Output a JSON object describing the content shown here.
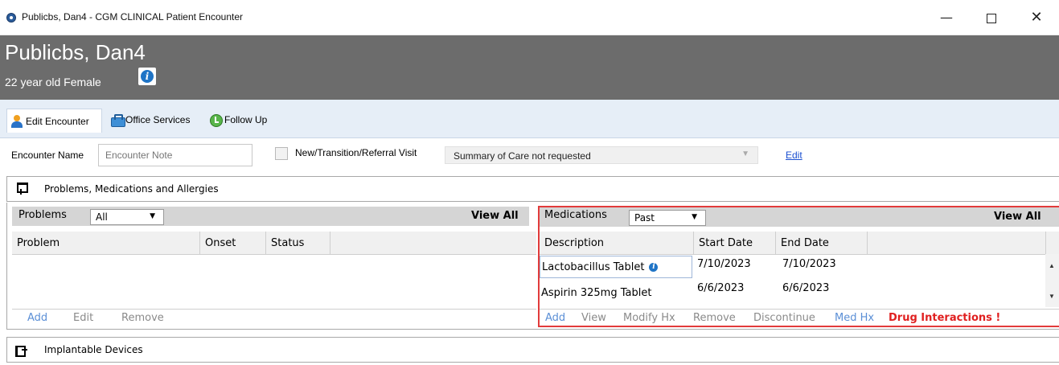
{
  "window": {
    "title": "Publicbs, Dan4 - CGM CLINICAL Patient Encounter",
    "minimize": "—",
    "close": "✕"
  },
  "patient": {
    "name": "Publicbs, Dan4",
    "summary": "22 year old Female",
    "info_icon": "i"
  },
  "tabs": [
    {
      "label": "Edit Encounter",
      "icon": "person-icon"
    },
    {
      "label": "Office Services",
      "icon": "bag-icon"
    },
    {
      "label": "Follow Up",
      "icon": "clock-icon"
    }
  ],
  "encounter": {
    "name_label": "Encounter Name",
    "note_placeholder": "Encounter Note",
    "visit_label": "New/Transition/Referral Visit",
    "summary_value": "Summary of Care not requested",
    "edit_link": "Edit"
  },
  "sections": {
    "pma_label": "Problems, Medications and Allergies",
    "devices_label": "Implantable Devices"
  },
  "problems": {
    "title": "Problems",
    "filter": "All",
    "view_all": "View All",
    "columns": [
      "Problem",
      "Onset",
      "Status"
    ],
    "actions": [
      "Add",
      "Edit",
      "Remove"
    ]
  },
  "medications": {
    "title": "Medications",
    "filter": "Past",
    "view_all": "View All",
    "columns": [
      "Description",
      "Start Date",
      "End Date"
    ],
    "rows": [
      {
        "description": "Lactobacillus Tablet",
        "start": "7/10/2023",
        "end": "7/10/2023"
      },
      {
        "description": "Aspirin 325mg Tablet",
        "start": "6/6/2023",
        "end": "6/6/2023"
      }
    ],
    "actions": [
      "Add",
      "View",
      "Modify Hx",
      "Remove",
      "Discontinue",
      "Med Hx"
    ],
    "alert": "Drug Interactions !"
  },
  "colors": {
    "header_bg": "#6c6c6c",
    "tab_strip": "#e6eef7",
    "alert_red": "#e02020",
    "highlight_border": "#e23b3b",
    "link_blue": "#1a4fd1"
  }
}
